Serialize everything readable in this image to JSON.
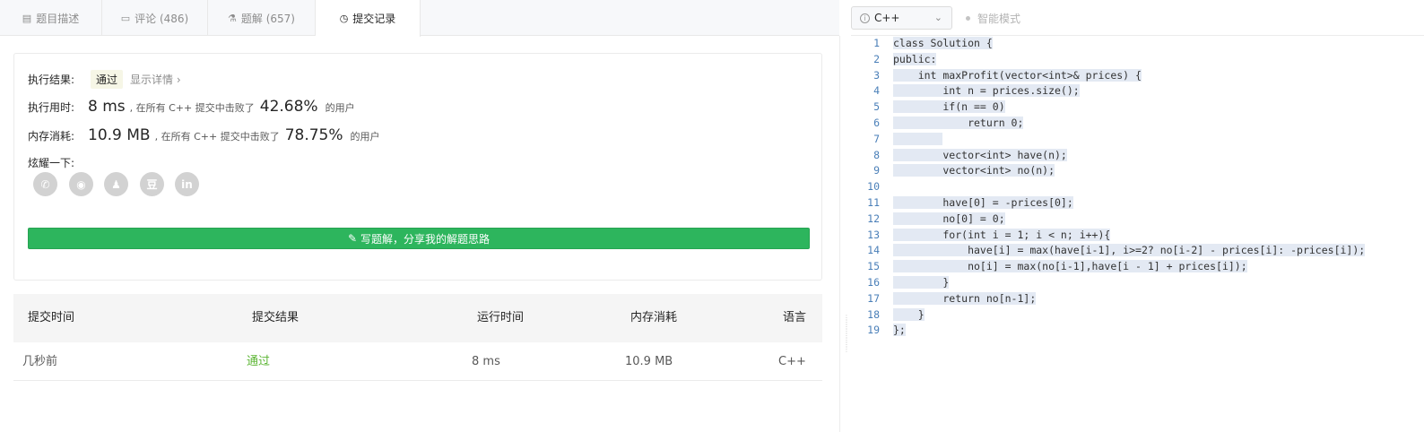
{
  "tabs": [
    {
      "label": "题目描述",
      "icon": "description-icon"
    },
    {
      "label": "评论 (486)",
      "icon": "comment-icon"
    },
    {
      "label": "题解 (657)",
      "icon": "flask-icon"
    },
    {
      "label": "提交记录",
      "icon": "clock-icon"
    }
  ],
  "result": {
    "status_label": "执行结果:",
    "status_value": "通过",
    "detail_link": "显示详情 ›",
    "time_label": "执行用时:",
    "time_value": "8 ms",
    "time_beat": ", 在所有 C++ 提交中击败了",
    "time_pct": "42.68%",
    "users": "的用户",
    "mem_label": "内存消耗:",
    "mem_value": "10.9 MB",
    "mem_beat": ", 在所有 C++ 提交中击败了",
    "mem_pct": "78.75%",
    "share_label": "炫耀一下:",
    "share_icons": [
      {
        "name": "wechat-icon",
        "glyph": "✆"
      },
      {
        "name": "weibo-icon",
        "glyph": "◉"
      },
      {
        "name": "qq-icon",
        "glyph": "♟"
      },
      {
        "name": "douban-icon",
        "glyph": "豆"
      },
      {
        "name": "linkedin-icon",
        "glyph": "in"
      }
    ],
    "write_button": "写题解，分享我的解题思路"
  },
  "table": {
    "headers": [
      "提交时间",
      "提交结果",
      "运行时间",
      "内存消耗",
      "语言"
    ],
    "rows": [
      [
        "几秒前",
        "通过",
        "8 ms",
        "10.9 MB",
        "C++"
      ]
    ]
  },
  "editor": {
    "language": "C++",
    "smart_mode": "智能模式",
    "lines": [
      "class Solution {",
      "public:",
      "    int maxProfit(vector<int>& prices) {",
      "        int n = prices.size();",
      "        if(n == 0)",
      "            return 0;",
      "        ",
      "        vector<int> have(n);",
      "        vector<int> no(n);",
      "",
      "        have[0] = -prices[0];",
      "        no[0] = 0;",
      "        for(int i = 1; i < n; i++){",
      "            have[i] = max(have[i-1], i>=2? no[i-2] - prices[i]: -prices[i]);",
      "            no[i] = max(no[i-1],have[i - 1] + prices[i]);",
      "        }",
      "        return no[n-1];",
      "    }",
      "};"
    ]
  }
}
